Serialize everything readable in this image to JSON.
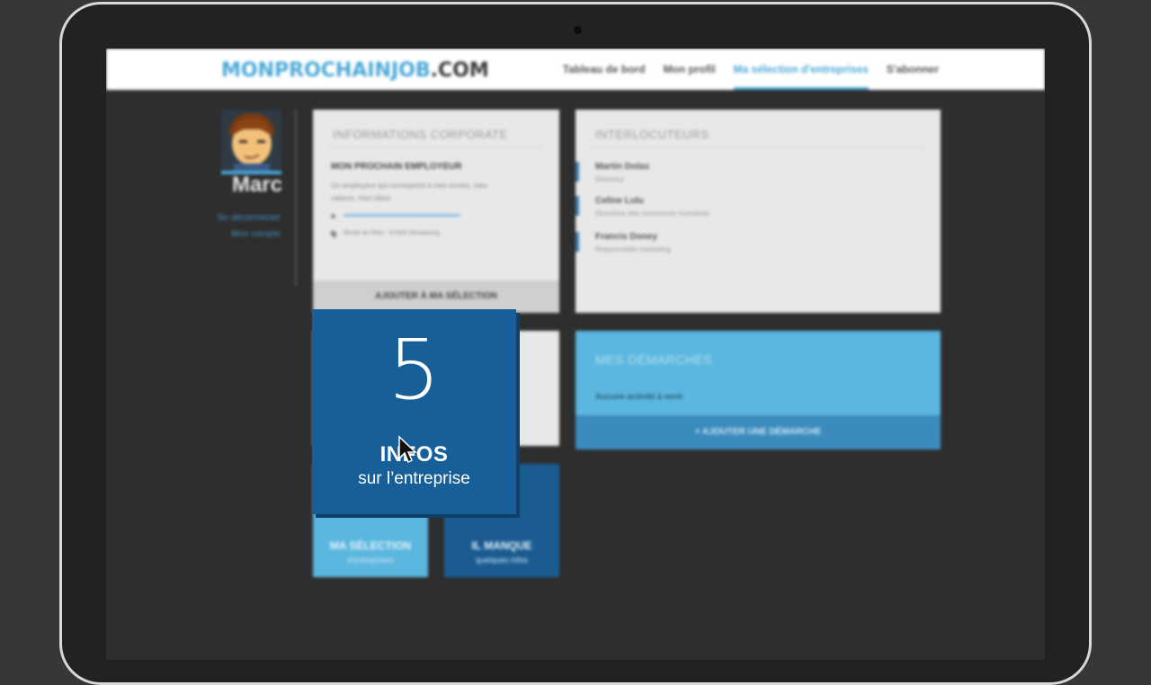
{
  "header": {
    "logo_part1": "MONPROCHAINJOB",
    "logo_part2": ".COM",
    "nav": [
      {
        "label": "Tableau de bord",
        "active": false
      },
      {
        "label": "Mon profil",
        "active": false
      },
      {
        "label": "Ma sélection d'entreprises",
        "active": true
      },
      {
        "label": "S'abonner",
        "active": false
      }
    ]
  },
  "sidebar": {
    "user_name": "Marc",
    "links": [
      "Se déconnecter",
      "Mon compte"
    ]
  },
  "corporate_card": {
    "title": "INFORMATIONS CORPORATE",
    "employer_name": "MON PROCHAIN EMPLOYEUR",
    "description": "Un employeur qui correspond à mes envies, mes valeurs, mes idées",
    "address": "Route du Rhin - 67000 Strasbourg",
    "footer_button": "AJOUTER À MA SÉLECTION"
  },
  "contacts_card": {
    "title": "INTERLOCUTEURS",
    "contacts": [
      {
        "name": "Martin Dolas",
        "role": "Directeur"
      },
      {
        "name": "Celine Lulu",
        "role": "Directrice des ressources humaines"
      },
      {
        "name": "Francis Doney",
        "role": "Responsable marketing"
      }
    ]
  },
  "steps_card": {
    "title": "MES DÉMARCHES",
    "empty_text": "Aucune activité à venir",
    "footer_button": "+ AJOUTER UNE DÉMARCHE"
  },
  "tiles": [
    {
      "title": "MA SÉLECTION",
      "subtitle": "d'entreprises"
    },
    {
      "title": "IL MANQUE",
      "subtitle": "quelques infos"
    }
  ],
  "info_overlay": {
    "number": "5",
    "label": "INFOS",
    "subtitle": "sur l’entreprise"
  },
  "colors": {
    "accent": "#4aa8d8",
    "dark_blue": "#165f98",
    "light_blue": "#5bb7df"
  }
}
